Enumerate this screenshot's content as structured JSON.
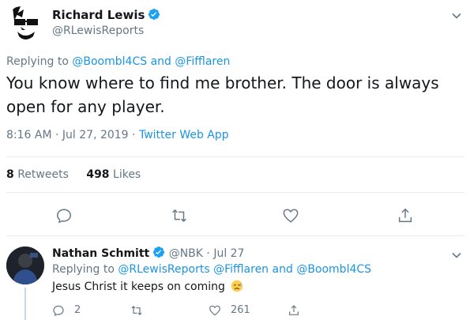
{
  "tweet": {
    "author_name": "Richard Lewis",
    "author_handle": "@RLewisReports",
    "replying_prefix": "Replying to",
    "replying_to_1": "@Boombl4CS",
    "replying_and": "and",
    "replying_to_2": "@Fifflaren",
    "text": "You know where to find me brother. The door is always open for any player.",
    "time": "8:16 AM",
    "separator": "·",
    "date": "Jul 27, 2019",
    "source": "Twitter Web App",
    "retweets_count": "8",
    "retweets_label": "Retweets",
    "likes_count": "498",
    "likes_label": "Likes"
  },
  "reply": {
    "author_name": "Nathan Schmitt",
    "author_handle": "@NBK",
    "separator": "·",
    "date": "Jul 27",
    "replying_prefix": "Replying to",
    "replying_to_1": "@RLewisReports",
    "replying_to_2": "@Fifflaren",
    "replying_and": "and",
    "replying_to_3": "@Boombl4CS",
    "text": "Jesus Christ it keeps on coming",
    "reply_count": "2",
    "like_count": "261"
  },
  "colors": {
    "link": "#1b95e0",
    "secondary": "#657786",
    "verified": "#1da1f2"
  },
  "icons": [
    "reply-icon",
    "retweet-icon",
    "like-icon",
    "share-icon",
    "verified-icon",
    "chevron-down-icon"
  ]
}
